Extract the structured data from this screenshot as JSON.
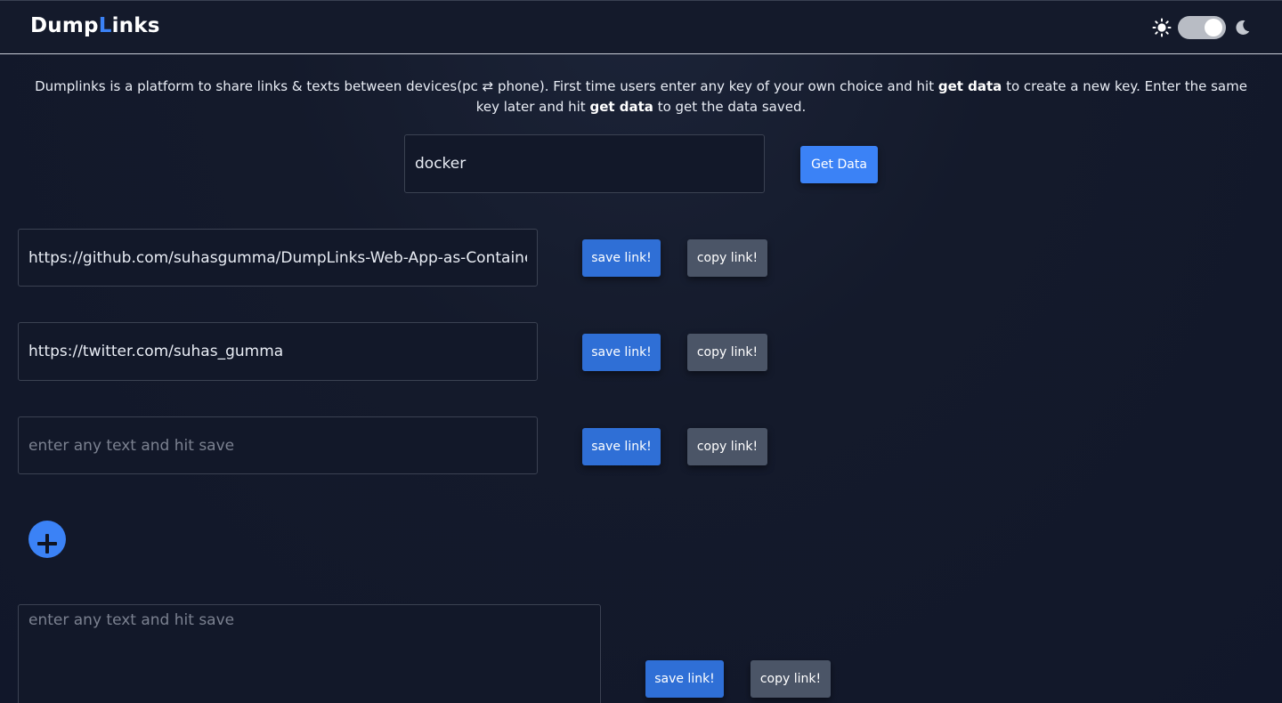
{
  "header": {
    "brand_prefix": "Dump",
    "brand_accent": "L",
    "brand_suffix": "inks",
    "theme_toggle": {
      "light_icon": "sun-icon",
      "dark_icon": "moon-icon",
      "state": "light"
    }
  },
  "intro": {
    "part1": "Dumplinks is a platform to share links & texts between devices(pc ",
    "arrow": "⇄",
    "part2": " phone). First time users enter any key of your own choice and hit ",
    "bold1": "get data",
    "part3": " to create a new key. Enter the same key later and hit ",
    "bold2": "get data",
    "part4": " to get the data saved."
  },
  "key_form": {
    "value": "docker",
    "button_label": "Get Data"
  },
  "links": [
    {
      "value": "https://github.com/suhasgumma/DumpLinks-Web-App-as-Containers",
      "placeholder": "enter any text and hit save",
      "save_label": "save link!",
      "copy_label": "copy link!"
    },
    {
      "value": "https://twitter.com/suhas_gumma",
      "placeholder": "enter any text and hit save",
      "save_label": "save link!",
      "copy_label": "copy link!"
    },
    {
      "value": "",
      "placeholder": "enter any text and hit save",
      "save_label": "save link!",
      "copy_label": "copy link!"
    }
  ],
  "add_button": {
    "icon": "plus-icon"
  },
  "text_area": {
    "value": "",
    "placeholder": "enter any text and hit save",
    "save_label": "save link!",
    "copy_label": "copy link!"
  },
  "colors": {
    "background": "#121829",
    "accent": "#3b82f6",
    "save_button": "#2f6fd6",
    "copy_button": "#4b5567"
  }
}
